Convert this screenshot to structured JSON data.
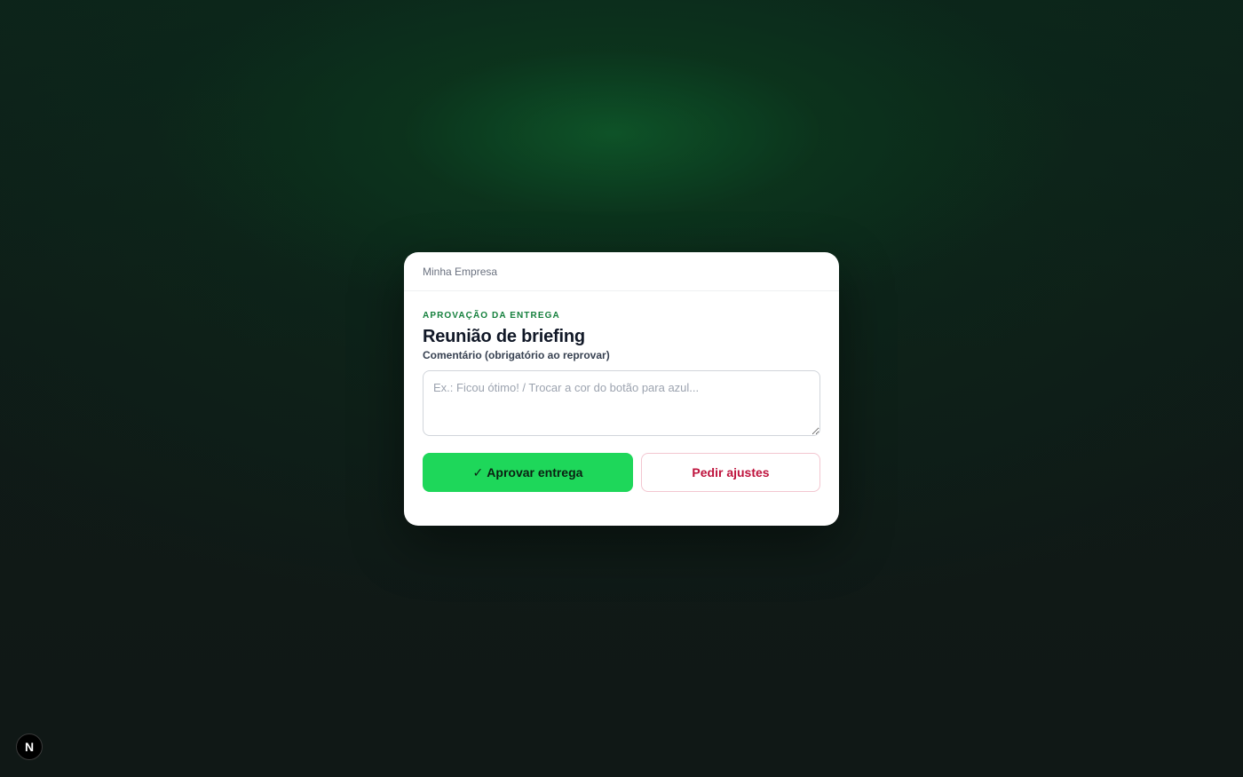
{
  "card": {
    "company_name": "Minha Empresa",
    "eyebrow": "APROVAÇÃO DA ENTREGA",
    "title": "Reunião de briefing",
    "comment": {
      "label": "Comentário (obrigatório ao reprovar)",
      "placeholder": "Ex.: Ficou ótimo! / Trocar a cor do botão para azul...",
      "value": ""
    },
    "actions": {
      "approve_icon": "✓",
      "approve_label": "Aprovar entrega",
      "adjust_label": "Pedir ajustes"
    }
  },
  "dev_badge": {
    "letter": "N",
    "icon": "nextjs-logo-icon"
  },
  "colors": {
    "background": "#0f1715",
    "accent_green": "#1ed75a",
    "eyebrow_green": "#15803d",
    "adjust_red": "#be123c"
  }
}
